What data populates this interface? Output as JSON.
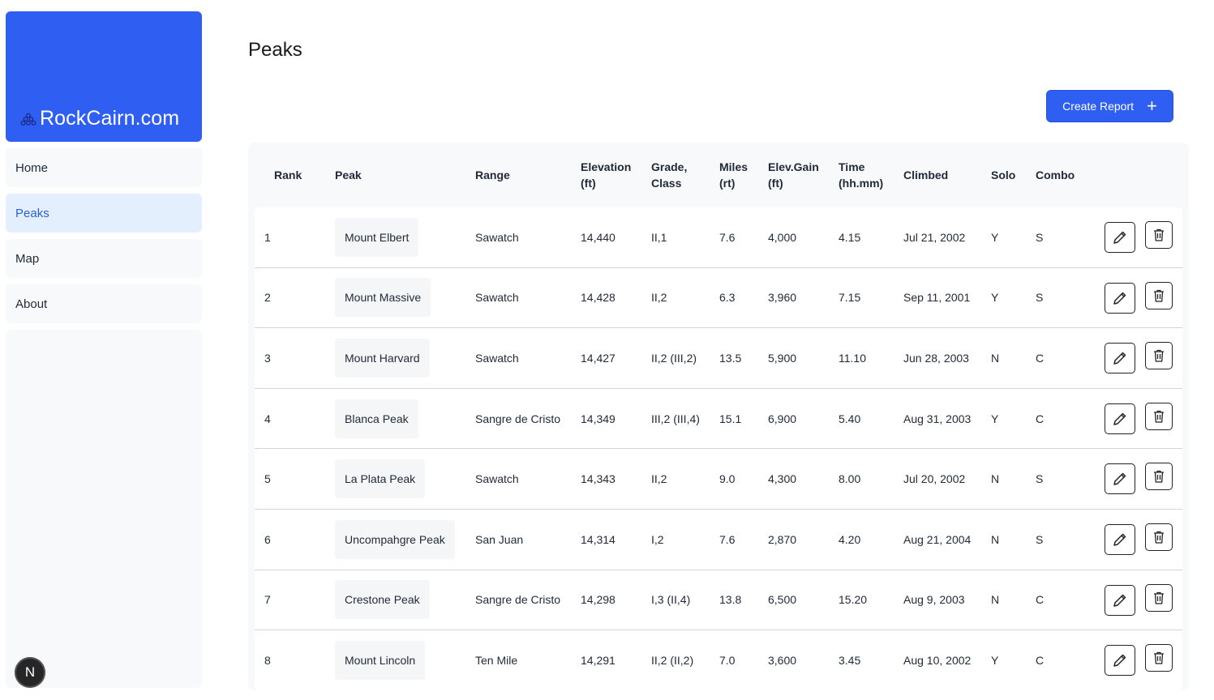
{
  "brand": {
    "name": "RockCairn.com",
    "color": "#2f5ff2"
  },
  "nav": [
    {
      "label": "Home",
      "icon": "home",
      "active": false
    },
    {
      "label": "Peaks",
      "icon": "mountain",
      "active": true
    },
    {
      "label": "Map",
      "icon": "map",
      "active": false
    },
    {
      "label": "About",
      "icon": "info",
      "active": false
    }
  ],
  "badge": {
    "letter": "N"
  },
  "page": {
    "title": "Peaks",
    "create_label": "Create Report"
  },
  "table": {
    "headers": {
      "rank": "Rank",
      "peak": "Peak",
      "range": "Range",
      "elevation_1": "Elevation",
      "elevation_2": "(ft)",
      "grade_1": "Grade,",
      "grade_2": "Class",
      "miles_1": "Miles",
      "miles_2": "(rt)",
      "gain_1": "Elev.Gain",
      "gain_2": "(ft)",
      "time_1": "Time",
      "time_2": "(hh.mm)",
      "climbed": "Climbed",
      "solo": "Solo",
      "combo": "Combo"
    },
    "rows": [
      {
        "rank": "1",
        "peak": "Mount Elbert",
        "range": "Sawatch",
        "elevation": "14,440",
        "grade": "II,1",
        "miles": "7.6",
        "gain": "4,000",
        "time": "4.15",
        "climbed": "Jul 21, 2002",
        "solo": "Y",
        "combo": "S"
      },
      {
        "rank": "2",
        "peak": "Mount Massive",
        "range": "Sawatch",
        "elevation": "14,428",
        "grade": "II,2",
        "miles": "6.3",
        "gain": "3,960",
        "time": "7.15",
        "climbed": "Sep 11, 2001",
        "solo": "Y",
        "combo": "S"
      },
      {
        "rank": "3",
        "peak": "Mount Harvard",
        "range": "Sawatch",
        "elevation": "14,427",
        "grade": "II,2 (III,2)",
        "miles": "13.5",
        "gain": "5,900",
        "time": "11.10",
        "climbed": "Jun 28, 2003",
        "solo": "N",
        "combo": "C"
      },
      {
        "rank": "4",
        "peak": "Blanca Peak",
        "range": "Sangre de Cristo",
        "elevation": "14,349",
        "grade": "III,2 (III,4)",
        "miles": "15.1",
        "gain": "6,900",
        "time": "5.40",
        "climbed": "Aug 31, 2003",
        "solo": "Y",
        "combo": "C"
      },
      {
        "rank": "5",
        "peak": "La Plata Peak",
        "range": "Sawatch",
        "elevation": "14,343",
        "grade": "II,2",
        "miles": "9.0",
        "gain": "4,300",
        "time": "8.00",
        "climbed": "Jul 20, 2002",
        "solo": "N",
        "combo": "S"
      },
      {
        "rank": "6",
        "peak": "Uncompahgre Peak",
        "range": "San Juan",
        "elevation": "14,314",
        "grade": "I,2",
        "miles": "7.6",
        "gain": "2,870",
        "time": "4.20",
        "climbed": "Aug 21, 2004",
        "solo": "N",
        "combo": "S"
      },
      {
        "rank": "7",
        "peak": "Crestone Peak",
        "range": "Sangre de Cristo",
        "elevation": "14,298",
        "grade": "I,3 (II,4)",
        "miles": "13.8",
        "gain": "6,500",
        "time": "15.20",
        "climbed": "Aug 9, 2003",
        "solo": "N",
        "combo": "C"
      },
      {
        "rank": "8",
        "peak": "Mount Lincoln",
        "range": "Ten Mile",
        "elevation": "14,291",
        "grade": "II,2 (II,2)",
        "miles": "7.0",
        "gain": "3,600",
        "time": "3.45",
        "climbed": "Aug 10, 2002",
        "solo": "Y",
        "combo": "C"
      }
    ],
    "row_actions": {
      "edit_icon": "pencil-icon",
      "delete_icon": "trash-icon"
    }
  }
}
